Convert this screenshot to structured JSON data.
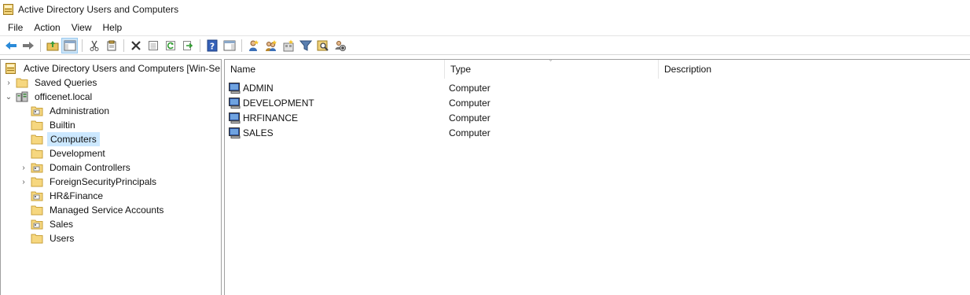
{
  "window": {
    "title": "Active Directory Users and Computers"
  },
  "menu": [
    "File",
    "Action",
    "View",
    "Help"
  ],
  "toolbar": {
    "buttons": [
      "back-icon",
      "forward-icon",
      "up-folder-icon",
      "show-hide-console-tree-icon",
      "cut-icon",
      "copy-icon",
      "delete-icon",
      "properties-icon",
      "refresh-icon",
      "export-list-icon",
      "help-icon",
      "show-action-pane-icon",
      "new-user-icon",
      "new-group-icon",
      "new-ou-icon",
      "filter-icon",
      "find-icon",
      "add-to-group-icon"
    ]
  },
  "tree": {
    "root_label": "Active Directory Users and Computers [Win-Serv",
    "saved_queries": "Saved Queries",
    "domain": "officenet.local",
    "children": [
      "Administration",
      "Builtin",
      "Computers",
      "Development",
      "Domain Controllers",
      "ForeignSecurityPrincipals",
      "HR&Finance",
      "Managed Service Accounts",
      "Sales",
      "Users"
    ],
    "selected": "Computers"
  },
  "list": {
    "columns": [
      "Name",
      "Type",
      "Description"
    ],
    "rows": [
      {
        "name": "ADMIN",
        "type": "Computer",
        "description": ""
      },
      {
        "name": "DEVELOPMENT",
        "type": "Computer",
        "description": ""
      },
      {
        "name": "HRFINANCE",
        "type": "Computer",
        "description": ""
      },
      {
        "name": "SALES",
        "type": "Computer",
        "description": ""
      }
    ]
  },
  "colors": {
    "selection": "#cce8ff",
    "folder": "#f3d37a",
    "accent": "#1e6fd0"
  }
}
